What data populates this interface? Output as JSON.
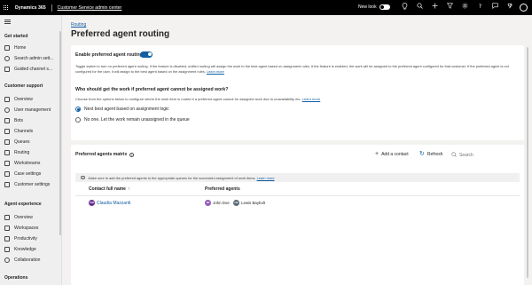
{
  "topbar": {
    "brand": "Dynamics 365",
    "app_name": "Customer Service admin center",
    "new_look_label": "New look",
    "icons": [
      "lightbulb-icon",
      "search-icon",
      "add-icon",
      "filter-icon",
      "settings-icon",
      "help-icon",
      "chat-icon",
      "copilot-icon"
    ],
    "avatar_initials": ""
  },
  "sidebar": {
    "groups": [
      {
        "label": "Get started",
        "items": [
          {
            "label": "Home",
            "icon": "home-icon"
          },
          {
            "label": "Search admin sett...",
            "icon": "search-icon"
          },
          {
            "label": "Guided channel s...",
            "icon": "rocket-icon"
          }
        ]
      },
      {
        "label": "Customer support",
        "items": [
          {
            "label": "Overview",
            "icon": "overview-icon"
          },
          {
            "label": "User management",
            "icon": "people-icon"
          },
          {
            "label": "Bots",
            "icon": "bot-icon"
          },
          {
            "label": "Channels",
            "icon": "channels-icon"
          },
          {
            "label": "Queues",
            "icon": "queue-icon"
          },
          {
            "label": "Routing",
            "icon": "routing-icon"
          },
          {
            "label": "Workstreams",
            "icon": "workstreams-icon"
          },
          {
            "label": "Case settings",
            "icon": "case-icon"
          },
          {
            "label": "Customer settings",
            "icon": "customer-icon"
          }
        ]
      },
      {
        "label": "Agent experience",
        "items": [
          {
            "label": "Overview",
            "icon": "overview-icon"
          },
          {
            "label": "Workspaces",
            "icon": "workspaces-icon"
          },
          {
            "label": "Productivity",
            "icon": "productivity-icon"
          },
          {
            "label": "Knowledge",
            "icon": "knowledge-icon"
          },
          {
            "label": "Collaboration",
            "icon": "collaboration-icon"
          }
        ]
      },
      {
        "label": "Operations",
        "items": []
      }
    ]
  },
  "main": {
    "breadcrumb": "Routing",
    "title": "Preferred agent routing",
    "enable_label": "Enable preferred agent routing",
    "enable_on": true,
    "description": "Toggle switch to turn on preferred agent routing. If the feature is disabled, unified routing will assign the work to the best agent based on assignment rules. If the feature is enabled, the work will be assigned to the preferred agent configured for that customer. If the preferred agent is not configured for the user, it will assign to the best agent based on the assignment rules.",
    "description_link": "Learn more",
    "question_title": "Who should get the work if preferred agent cannot be assigned work?",
    "question_desc": "Choose from the options below to configure where the work item is routed if a preferred agent cannot be assigned work due to unavailability etc.",
    "question_link": "Learn more",
    "radio_options": [
      {
        "label": "Next best agent based on assignment logic",
        "selected": true
      },
      {
        "label": "No one. Let the work remain unassigned in the queue",
        "selected": false
      }
    ]
  },
  "matrix": {
    "title": "Preferred agents matrix",
    "add_contact": "Add a contact",
    "refresh": "Refresh",
    "search_placeholder": "Search",
    "banner_text": "Make sure to add the preferred agents to the appropriate queues for the successful assignment of work items.",
    "banner_link": "Learn more",
    "columns": [
      "Contact full name",
      "Preferred agents"
    ],
    "rows": [
      {
        "contact": {
          "name": "Claudia Mazzanti",
          "initials": "CM",
          "color": "#6b2e8f"
        },
        "agents": [
          {
            "name": "John Doe",
            "initials": "JD",
            "color": "#8e5cb8"
          },
          {
            "name": "Lewis Baybolt",
            "initials": "LB",
            "color": "#5b6b7a"
          }
        ]
      }
    ]
  },
  "colors": {
    "accent": "#115ea3",
    "topbar": "#000000"
  }
}
